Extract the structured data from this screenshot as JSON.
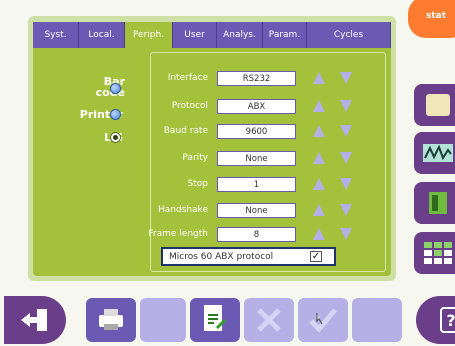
{
  "header": {
    "status_label": "stat"
  },
  "tabs": [
    {
      "label": "Syst.",
      "active": false
    },
    {
      "label": "Local.",
      "active": false
    },
    {
      "label": "Periph.",
      "active": true
    },
    {
      "label": "User",
      "active": false
    },
    {
      "label": "Analys.",
      "active": false
    },
    {
      "label": "Param.",
      "active": false
    },
    {
      "label": "Cycles",
      "active": false
    }
  ],
  "periph": {
    "options": [
      {
        "label_line1": "Bar",
        "label_line2": "code",
        "selected": false
      },
      {
        "label": "Printer",
        "selected": false
      },
      {
        "label": "LIS",
        "selected": true
      }
    ],
    "settings": [
      {
        "label": "Interface",
        "value": "RS232"
      },
      {
        "label": "Protocol",
        "value": "ABX"
      },
      {
        "label": "Baud rate",
        "value": "9600"
      },
      {
        "label": "Parity",
        "value": "None"
      },
      {
        "label": "Stop",
        "value": "1"
      },
      {
        "label": "Handshake",
        "value": "None"
      },
      {
        "label": "Frame length",
        "value": "8"
      }
    ],
    "micros_protocol": {
      "label": "Micros 60 ABX protocol",
      "checked": true,
      "check_glyph": "✓"
    }
  },
  "right_buttons": [
    {
      "icon": "specimen-icon"
    },
    {
      "icon": "waveform-icon"
    },
    {
      "icon": "reagent-icon"
    },
    {
      "icon": "grid-icon"
    }
  ],
  "bottom_buttons": [
    {
      "icon": "exit-door-icon"
    },
    {
      "icon": "printer-icon"
    },
    {
      "icon": "blank-icon"
    },
    {
      "icon": "document-edit-icon"
    },
    {
      "icon": "cancel-x-icon"
    },
    {
      "icon": "validate-check-icon"
    },
    {
      "icon": "blank-disabled-icon"
    },
    {
      "icon": "help-icon"
    }
  ],
  "colors": {
    "accent_purple": "#6a3e88",
    "tab_purple": "#6a5ab3",
    "panel_green": "#a4c13c",
    "status_orange": "#ff7b2f"
  }
}
